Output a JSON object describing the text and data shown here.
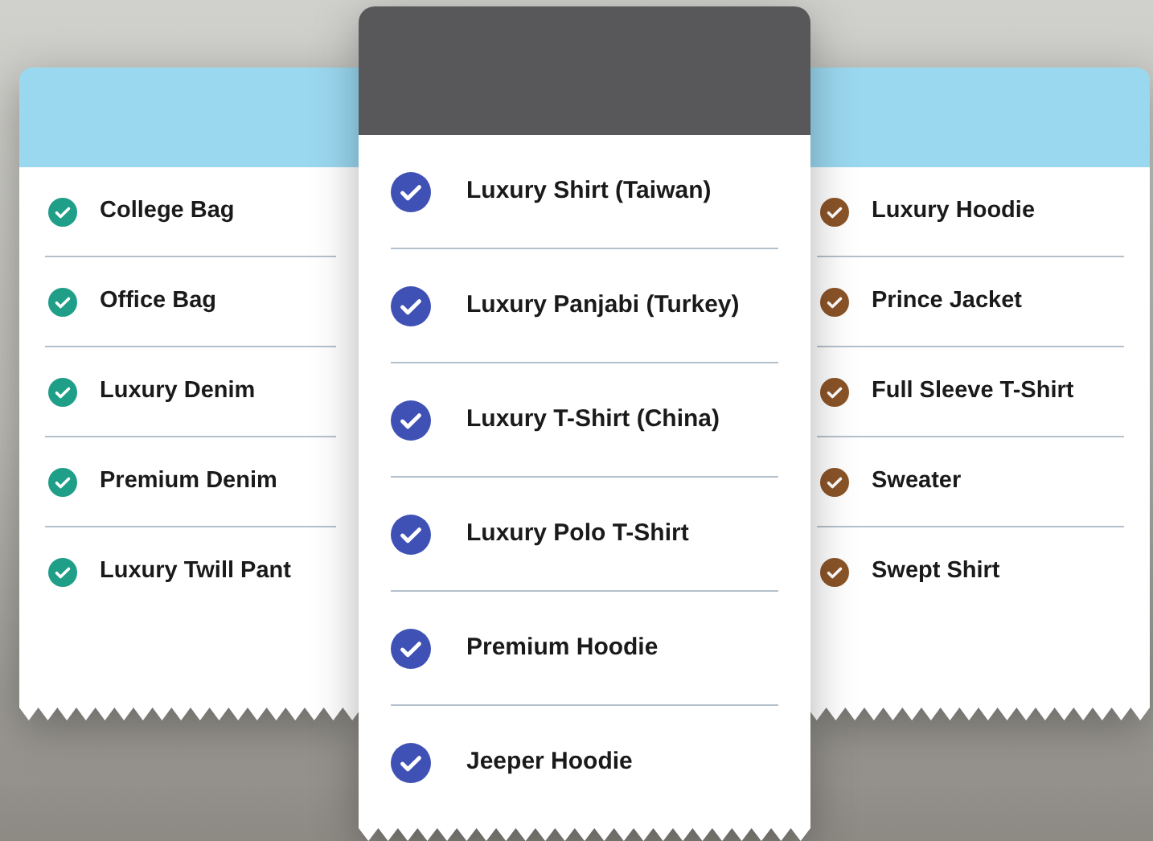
{
  "cards": [
    {
      "kind": "standard",
      "color": "#1f9e88",
      "items": [
        "College Bag",
        "Office Bag",
        "Luxury Denim",
        "Premium Denim",
        "Luxury Twill Pant"
      ]
    },
    {
      "kind": "featured",
      "color": "#3f51b5",
      "items": [
        "Luxury Shirt (Taiwan)",
        "Luxury Panjabi (Turkey)",
        "Luxury T-Shirt (China)",
        "Luxury Polo T-Shirt",
        "Premium Hoodie",
        "Jeeper Hoodie"
      ]
    },
    {
      "kind": "standard",
      "color": "#8b5428",
      "items": [
        "Luxury Hoodie",
        "Prince Jacket",
        "Full Sleeve T-Shirt",
        "Sweater",
        "Swept Shirt"
      ]
    }
  ]
}
